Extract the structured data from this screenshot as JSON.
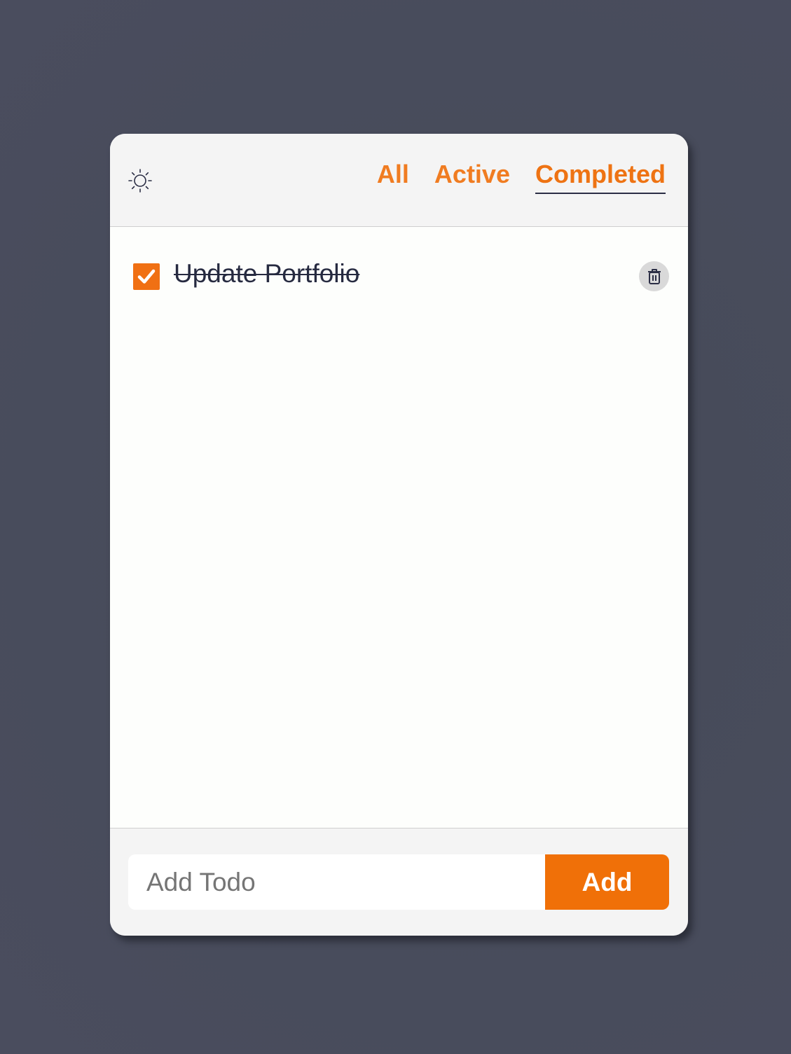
{
  "header": {
    "theme_icon": "sun-icon",
    "tabs": [
      {
        "label": "All",
        "active": false
      },
      {
        "label": "Active",
        "active": false
      },
      {
        "label": "Completed",
        "active": true
      }
    ]
  },
  "todos": [
    {
      "text": "Update Portfolio",
      "completed": true,
      "check_icon": "checkmark-icon",
      "delete_icon": "trash-icon"
    }
  ],
  "footer": {
    "input_placeholder": "Add Todo",
    "input_value": "",
    "add_label": "Add"
  },
  "colors": {
    "accent": "#f07013",
    "tab_text": "#f07c21",
    "text_dark": "#262a40",
    "background": "#4a4d5e"
  }
}
